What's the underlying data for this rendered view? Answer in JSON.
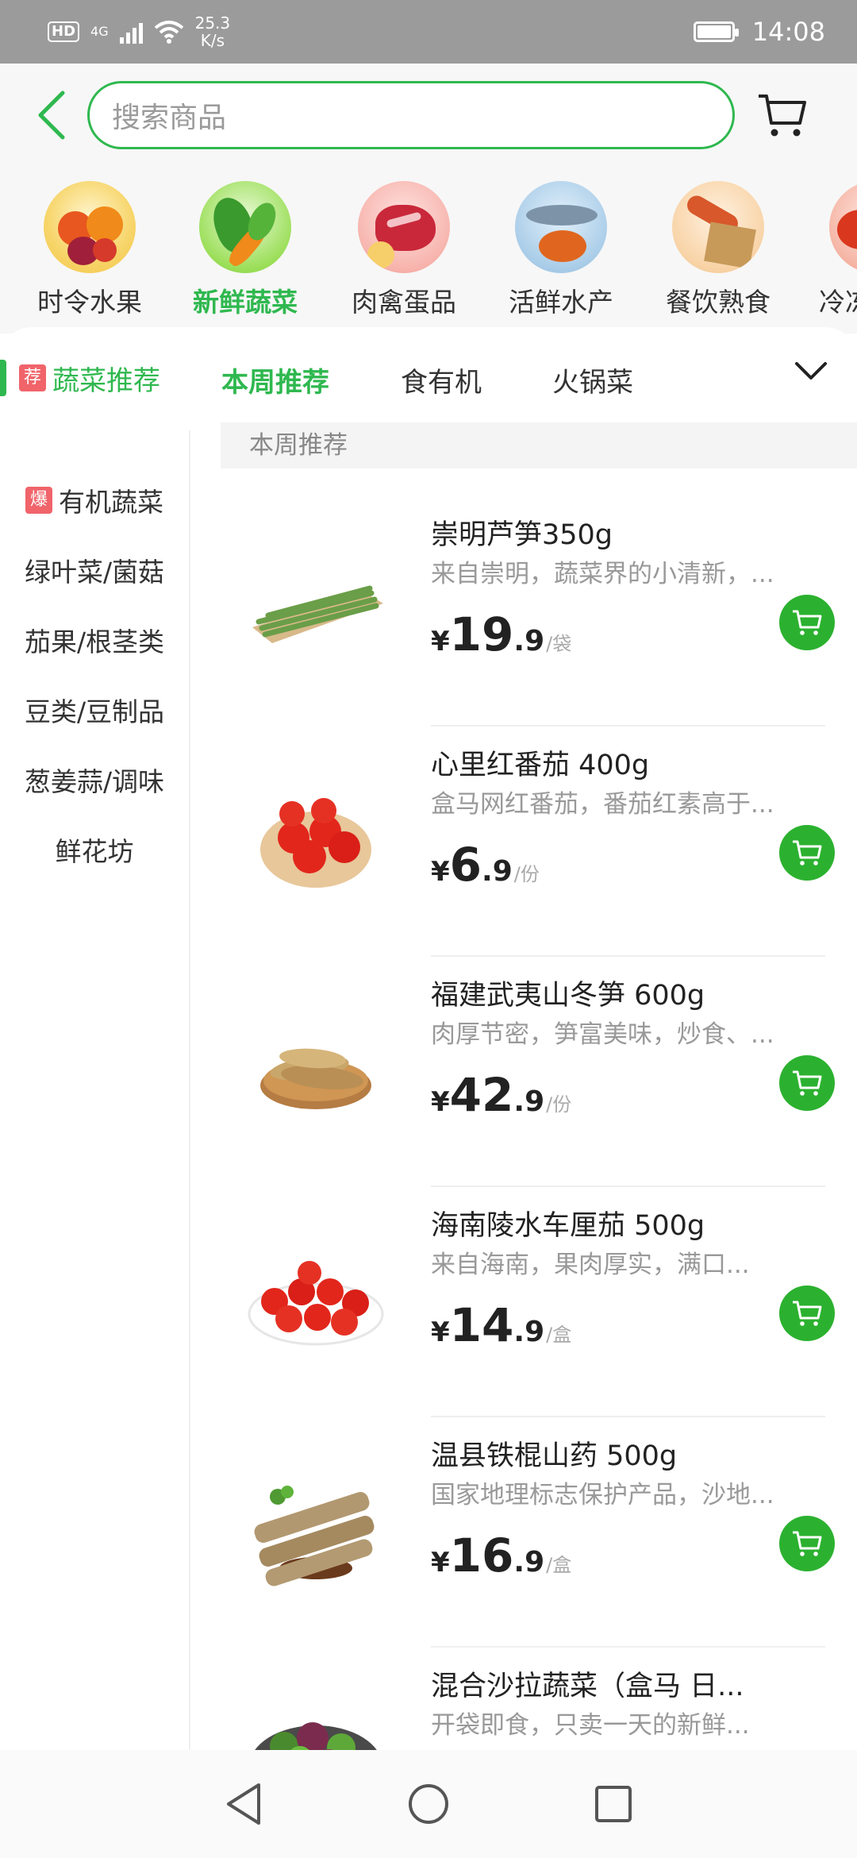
{
  "status_bar": {
    "hd": "HD",
    "network": "4G",
    "speed": "25.3",
    "speed_unit": "K/s",
    "time": "14:08"
  },
  "search": {
    "placeholder": "搜索商品"
  },
  "categories": [
    {
      "label": "时令水果"
    },
    {
      "label": "新鲜蔬菜",
      "active": true
    },
    {
      "label": "肉禽蛋品"
    },
    {
      "label": "活鲜水产"
    },
    {
      "label": "餐饮熟食"
    },
    {
      "label": "冷冻"
    }
  ],
  "left_selected": {
    "tag": "荐",
    "label": "蔬菜推荐"
  },
  "tabs": [
    {
      "label": "本周推荐",
      "active": true
    },
    {
      "label": "食有机"
    },
    {
      "label": "火锅菜"
    }
  ],
  "sidebar": [
    {
      "tag": "爆",
      "label": "有机蔬菜"
    },
    {
      "label": "绿叶菜/菌菇"
    },
    {
      "label": "茄果/根茎类"
    },
    {
      "label": "豆类/豆制品"
    },
    {
      "label": "葱姜蒜/调味"
    },
    {
      "label": "鲜花坊"
    }
  ],
  "section_title": "本周推荐",
  "products": [
    {
      "name": "崇明芦笋350g",
      "desc": "来自崇明，蔬菜界的小清新，...",
      "currency": "¥",
      "price_int": "19",
      "price_dec": ".9",
      "unit": "/袋",
      "image": "asparagus"
    },
    {
      "name": "心里红番茄 400g",
      "desc": "盒马网红番茄，番茄红素高于...",
      "currency": "¥",
      "price_int": "6",
      "price_dec": ".9",
      "unit": "/份",
      "image": "tomatoes-plate"
    },
    {
      "name": "福建武夷山冬笋 600g",
      "desc": "肉厚节密，笋富美味，炒食、...",
      "currency": "¥",
      "price_int": "42",
      "price_dec": ".9",
      "unit": "/份",
      "image": "bamboo-shoots"
    },
    {
      "name": "海南陵水车厘茄 500g",
      "desc": "来自海南，果肉厚实，满口...",
      "currency": "¥",
      "price_int": "14",
      "price_dec": ".9",
      "unit": "/盒",
      "image": "cherry-tomatoes"
    },
    {
      "name": "温县铁棍山药 500g",
      "desc": "国家地理标志保护产品，沙地...",
      "currency": "¥",
      "price_int": "16",
      "price_dec": ".9",
      "unit": "/盒",
      "image": "yam"
    },
    {
      "name": "混合沙拉蔬菜（盒马 日...",
      "desc": "开袋即食，只卖一天的新鲜...",
      "image": "salad"
    }
  ],
  "colors": {
    "accent": "#2fb84f",
    "cart_button": "#2bb12f",
    "tag": "#f0646a"
  }
}
